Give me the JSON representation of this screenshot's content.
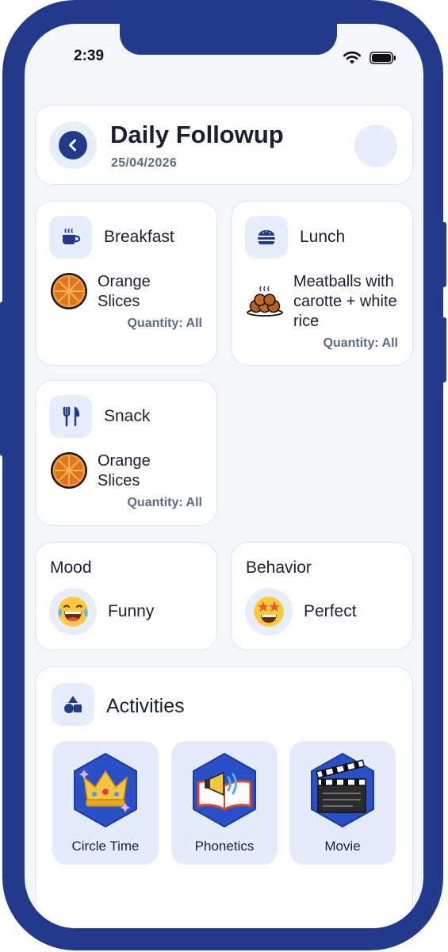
{
  "status_bar": {
    "time": "2:39"
  },
  "header": {
    "title": "Daily Followup",
    "date": "25/04/2026"
  },
  "meals": {
    "breakfast": {
      "title": "Breakfast",
      "food": "Orange Slices",
      "quantity": "Quantity: All",
      "icon": "coffee-cup-icon"
    },
    "lunch": {
      "title": "Lunch",
      "food": "Meatballs with carotte + white rice",
      "quantity": "Quantity: All",
      "icon": "burger-icon"
    },
    "snack": {
      "title": "Snack",
      "food": "Orange Slices",
      "quantity": "Quantity: All",
      "icon": "fork-knife-icon"
    }
  },
  "mood": {
    "label": "Mood",
    "value": "Funny",
    "icon": "laughing-emoji-icon"
  },
  "behavior": {
    "label": "Behavior",
    "value": "Perfect",
    "icon": "star-eyes-emoji-icon"
  },
  "activities": {
    "title": "Activities",
    "items": [
      {
        "label": "Circle Time",
        "icon": "crown-icon"
      },
      {
        "label": "Phonetics",
        "icon": "book-megaphone-icon"
      },
      {
        "label": "Movie",
        "icon": "clapperboard-icon"
      }
    ]
  },
  "colors": {
    "frame": "#22398c",
    "background": "#f3f6fb",
    "accent_light": "#e6edfb",
    "text": "#1a2033",
    "muted": "#5b6a85"
  }
}
